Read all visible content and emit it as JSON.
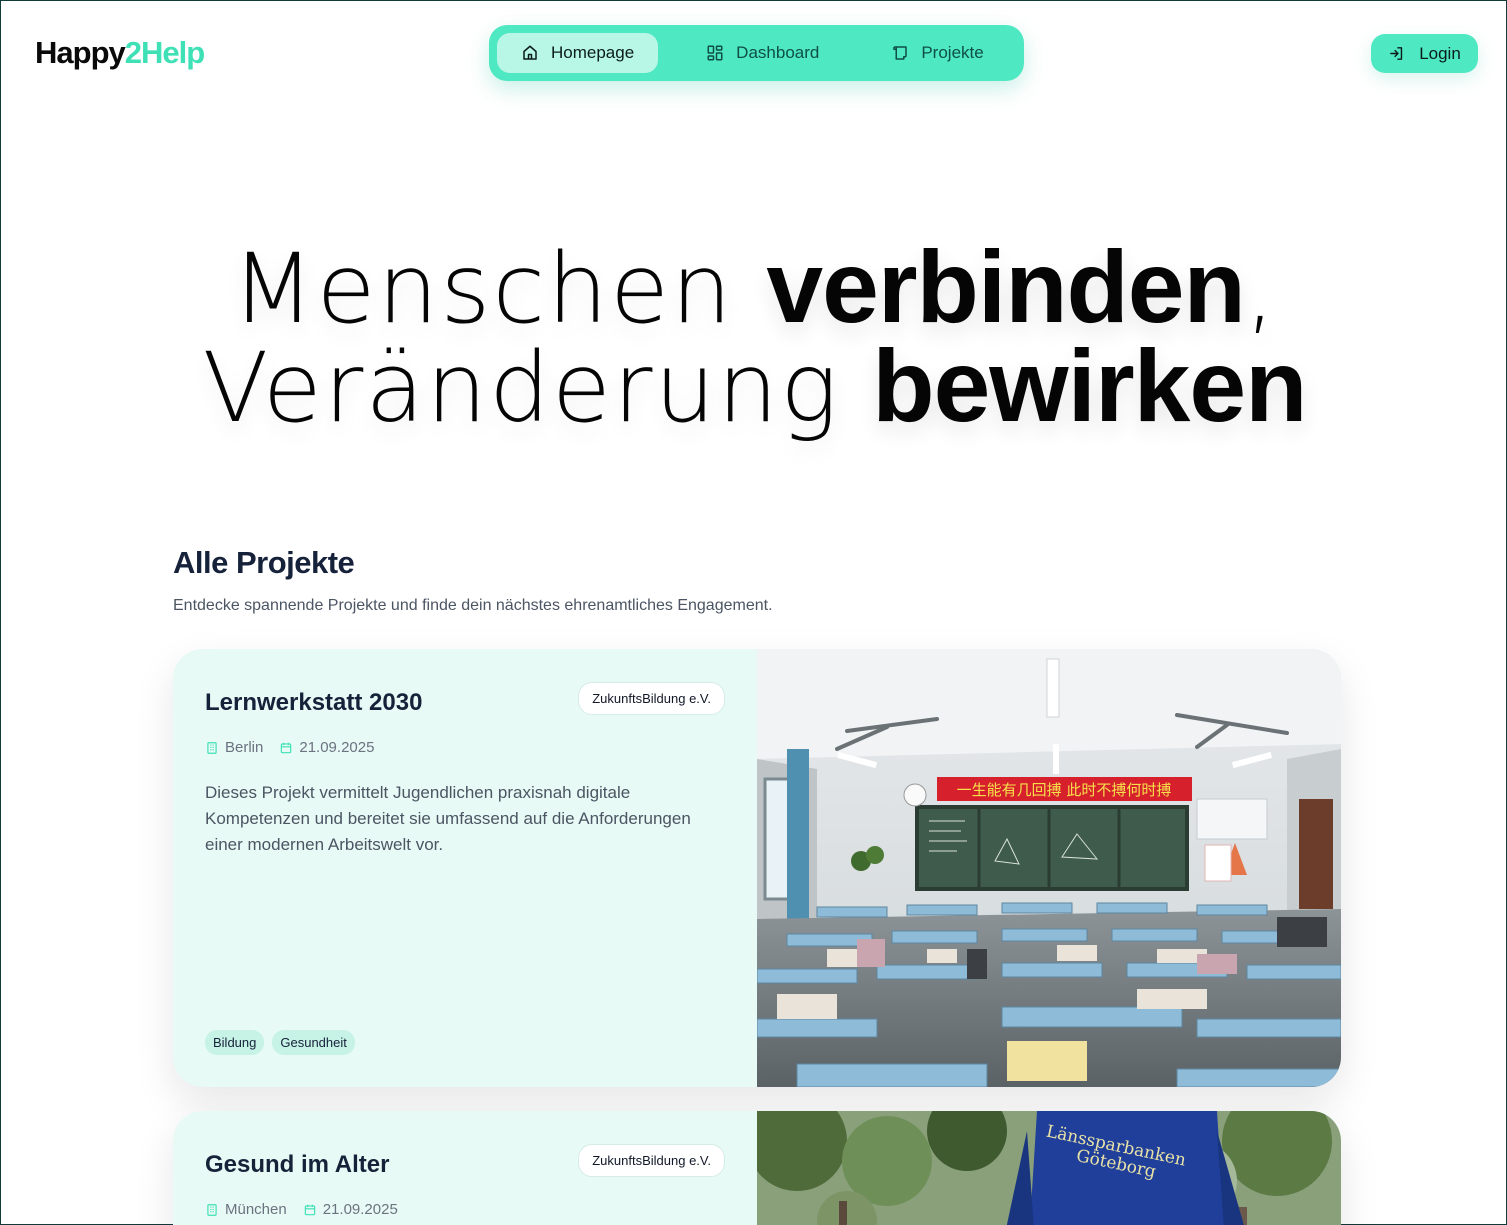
{
  "brand": {
    "name_main": "Happy",
    "name_accent": "2Help",
    "accent_color": "#3ee0b5"
  },
  "nav": {
    "items": [
      {
        "label": "Homepage",
        "icon": "home-icon",
        "active": true
      },
      {
        "label": "Dashboard",
        "icon": "dashboard-icon",
        "active": false
      },
      {
        "label": "Projekte",
        "icon": "scroll-icon",
        "active": false
      }
    ],
    "color": "#4ee8c2"
  },
  "login": {
    "label": "Login",
    "icon": "login-icon"
  },
  "hero": {
    "line1_light": "Menschen ",
    "line1_bold": "verbinden",
    "line1_tail": ",",
    "line2_light": "Veränderung ",
    "line2_bold": "bewirken"
  },
  "projects": {
    "title": "Alle Projekte",
    "subtitle": "Entdecke spannende Projekte und finde dein nächstes ehrenamtliches Engagement.",
    "items": [
      {
        "title": "Lernwerkstatt 2030",
        "organization": "ZukunftsBildung e.V.",
        "city": "Berlin",
        "date": "21.09.2025",
        "description": "Dieses Projekt vermittelt Jugendlichen praxisnah digitale Kompetenzen und bereitet sie umfassend auf die Anforderungen einer modernen Arbeitswelt vor.",
        "tags": [
          "Bildung",
          "Gesundheit"
        ],
        "image": "classroom-photo",
        "banner_text": "一生能有几回搏 此时不搏何时搏"
      },
      {
        "title": "Gesund im Alter",
        "organization": "ZukunftsBildung e.V.",
        "city": "München",
        "date": "21.09.2025",
        "image": "park-jacket-photo",
        "jacket_text_1": "Länssparbanken",
        "jacket_text_2": "Göteborg"
      }
    ]
  }
}
